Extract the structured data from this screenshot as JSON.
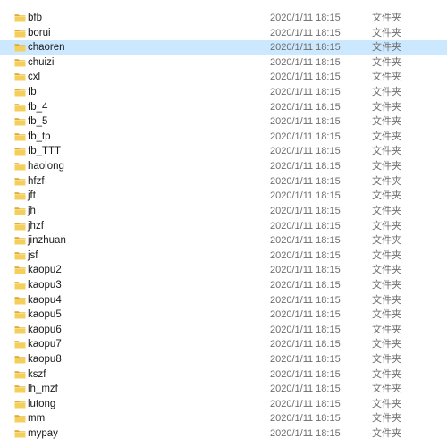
{
  "folder_type_label": "文件夹",
  "folder_icon": "folder-icon",
  "colors": {
    "folder": "#f0c94f",
    "folder_dark": "#d9a62e",
    "selected_row": "#cce8ff",
    "text_gray": "#6d6d6d"
  },
  "files": [
    {
      "name": "bfb",
      "modified": "2020/1/11 18:15",
      "type": "文件夹"
    },
    {
      "name": "borui",
      "modified": "2020/1/11 18:15",
      "type": "文件夹"
    },
    {
      "name": "chaoren",
      "modified": "2020/1/11 18:15",
      "type": "文件夹",
      "selected": true
    },
    {
      "name": "chuizi",
      "modified": "2020/1/11 18:15",
      "type": "文件夹"
    },
    {
      "name": "cxl",
      "modified": "2020/1/11 18:15",
      "type": "文件夹"
    },
    {
      "name": "fb",
      "modified": "2020/1/11 18:15",
      "type": "文件夹"
    },
    {
      "name": "fb_4",
      "modified": "2020/1/11 18:15",
      "type": "文件夹"
    },
    {
      "name": "fb_5",
      "modified": "2020/1/11 18:15",
      "type": "文件夹"
    },
    {
      "name": "fb_tp",
      "modified": "2020/1/11 18:15",
      "type": "文件夹"
    },
    {
      "name": "fb_TTT",
      "modified": "2020/1/11 18:15",
      "type": "文件夹"
    },
    {
      "name": "haolong",
      "modified": "2020/1/11 18:15",
      "type": "文件夹"
    },
    {
      "name": "hfzf",
      "modified": "2020/1/11 18:15",
      "type": "文件夹"
    },
    {
      "name": "jft",
      "modified": "2020/1/11 18:15",
      "type": "文件夹"
    },
    {
      "name": "jh",
      "modified": "2020/1/11 18:15",
      "type": "文件夹"
    },
    {
      "name": "jhzf",
      "modified": "2020/1/11 18:15",
      "type": "文件夹"
    },
    {
      "name": "jinzhuan",
      "modified": "2020/1/11 18:15",
      "type": "文件夹"
    },
    {
      "name": "jsf",
      "modified": "2020/1/11 18:15",
      "type": "文件夹"
    },
    {
      "name": "kaopu2",
      "modified": "2020/1/11 18:15",
      "type": "文件夹"
    },
    {
      "name": "kaopu3",
      "modified": "2020/1/11 18:15",
      "type": "文件夹"
    },
    {
      "name": "kaopu4",
      "modified": "2020/1/11 18:15",
      "type": "文件夹"
    },
    {
      "name": "kaopu5",
      "modified": "2020/1/11 18:15",
      "type": "文件夹"
    },
    {
      "name": "kaopu6",
      "modified": "2020/1/11 18:15",
      "type": "文件夹"
    },
    {
      "name": "kaopu7",
      "modified": "2020/1/11 18:15",
      "type": "文件夹"
    },
    {
      "name": "kaopu8",
      "modified": "2020/1/11 18:15",
      "type": "文件夹"
    },
    {
      "name": "kszf",
      "modified": "2020/1/11 18:15",
      "type": "文件夹"
    },
    {
      "name": "lh_mzf",
      "modified": "2020/1/11 18:15",
      "type": "文件夹"
    },
    {
      "name": "lutong",
      "modified": "2020/1/11 18:15",
      "type": "文件夹"
    },
    {
      "name": "mm",
      "modified": "2020/1/11 18:15",
      "type": "文件夹"
    },
    {
      "name": "mypay",
      "modified": "2020/1/11 18:15",
      "type": "文件夹"
    }
  ]
}
